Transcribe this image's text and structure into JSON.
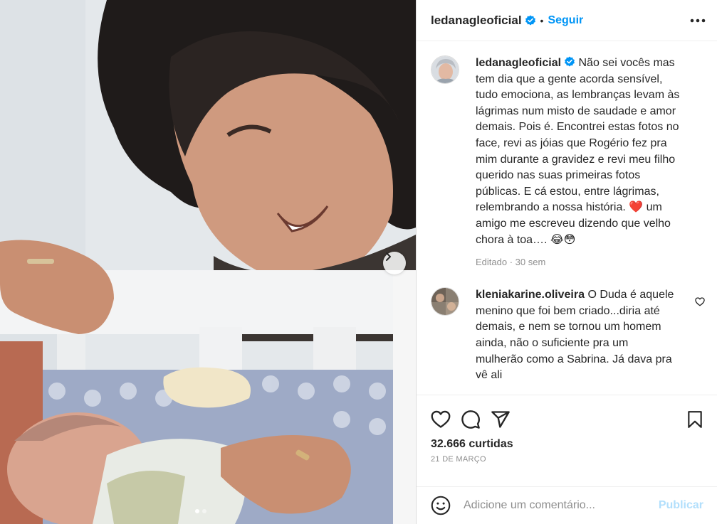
{
  "header": {
    "username": "ledanagleoficial",
    "separator": "•",
    "follow_label": "Seguir"
  },
  "caption": {
    "username": "ledanagleoficial",
    "text": "Não sei vocês mas tem dia que a gente acorda sensível, tudo emociona, as lembranças levam às lágrimas num misto de saudade e amor demais. Pois é. Encontrei estas fotos no face, revi as jóias que Rogério fez pra mim durante a gravidez e revi meu filho querido nas suas primeiras fotos públicas. E cá estou, entre lágrimas, relembrando a nossa história. ❤️ um amigo me escreveu dizendo que velho chora à toa…. 😂😳",
    "meta": "Editado · 30 sem"
  },
  "comment": {
    "username": "kleniakarine.oliveira",
    "text": "O Duda é aquele menino que foi bem criado...diria até demais, e nem se tornou um homem ainda, não o suficiente pra um mulherão como a Sabrina. Já dava pra vê ali"
  },
  "post": {
    "likes": "32.666 curtidas",
    "date": "21 DE MARÇO"
  },
  "add_comment": {
    "placeholder": "Adicione um comentário...",
    "publish_label": "Publicar"
  },
  "carousel": {
    "slide_count": 2,
    "active_index": 0
  },
  "colors": {
    "accent": "#0095f6",
    "publish_disabled": "#b2dffc",
    "verified": "#0095f6",
    "heart": "#e0245e"
  },
  "icons": [
    "verified-icon",
    "more-icon",
    "chevron-right-icon",
    "heart-icon",
    "comment-icon",
    "share-icon",
    "bookmark-icon",
    "emoji-icon"
  ]
}
